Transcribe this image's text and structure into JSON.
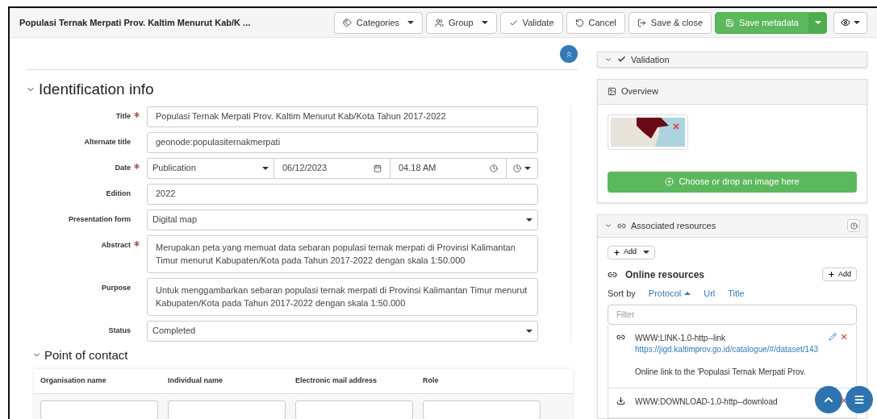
{
  "header": {
    "title": "Populasi Ternak Merpati Prov. Kaltim Menurut Kab/K ...",
    "buttons": [
      {
        "label": "Categories",
        "kind": "menu"
      },
      {
        "label": "Group",
        "kind": "menu"
      },
      {
        "label": "Validate",
        "kind": "plain"
      },
      {
        "label": "Cancel",
        "kind": "plain"
      },
      {
        "label": "Save & close",
        "kind": "plain"
      },
      {
        "label": "Save metadata",
        "kind": "split-primary"
      },
      {
        "kind": "icon-menu"
      }
    ]
  },
  "identification": {
    "title": "Identification info",
    "fields": [
      {
        "kind": "text",
        "label": "Title",
        "required": true,
        "value": "Populasi Ternak Merpati Prov. Kaltim Menurut Kab/Kota Tahun 2017-2022"
      },
      {
        "kind": "text",
        "label": "Alternate title",
        "required": false,
        "value": "geonode:populasiternakmerpati"
      },
      {
        "kind": "date",
        "label": "Date",
        "required": true,
        "type_value": "Publication",
        "date": "06/12/2023",
        "time": "04.18 AM"
      },
      {
        "kind": "text",
        "label": "Edition",
        "required": false,
        "value": "2022"
      },
      {
        "kind": "select",
        "label": "Presentation form",
        "required": false,
        "value": "Digital map"
      },
      {
        "kind": "textarea",
        "label": "Abstract",
        "required": true,
        "value": "Merupakan peta yang memuat data sebaran populasi ternak merpati di Provinsi Kalimantan Timur menurut Kabupaten/Kota pada Tahun 2017-2022 dengan skala 1:50.000"
      },
      {
        "kind": "textarea",
        "label": "Purpose",
        "required": false,
        "value": "Untuk menggambarkan sebaran populasi ternak merpati di Provinsi Kalimantan Timur menurut Kabupaten/Kota pada Tahun 2017-2022 dengan skala 1:50.000"
      },
      {
        "kind": "select",
        "label": "Status",
        "required": false,
        "value": "Completed"
      }
    ]
  },
  "contact": {
    "title": "Point of contact",
    "columns": [
      "Organisation name",
      "Individual name",
      "Electronic mail address",
      "Role"
    ]
  },
  "validation": {
    "title": "Validation",
    "expanded": false
  },
  "overview": {
    "title": "Overview",
    "button": "Choose or drop an image here"
  },
  "associated": {
    "title": "Associated resources",
    "add_menu": "Add",
    "section_title": "Online resources",
    "section_add": "Add",
    "sort_label": "Sort by",
    "sort_options": [
      {
        "label": "Protocol",
        "selected": true
      },
      {
        "label": "Url",
        "selected": false
      },
      {
        "label": "Title",
        "selected": false
      }
    ],
    "filter_placeholder": "Filter",
    "resources": [
      {
        "kind": "link",
        "protocol": "WWW:LINK-1.0-http--link",
        "url": "https://jigd.kaltimprov.go.id/catalogue/#/dataset/143",
        "description": "Online link to the 'Populasi Ternak Merpati Prov."
      },
      {
        "kind": "download",
        "protocol": "WWW:DOWNLOAD-1.0-http--download"
      }
    ]
  }
}
